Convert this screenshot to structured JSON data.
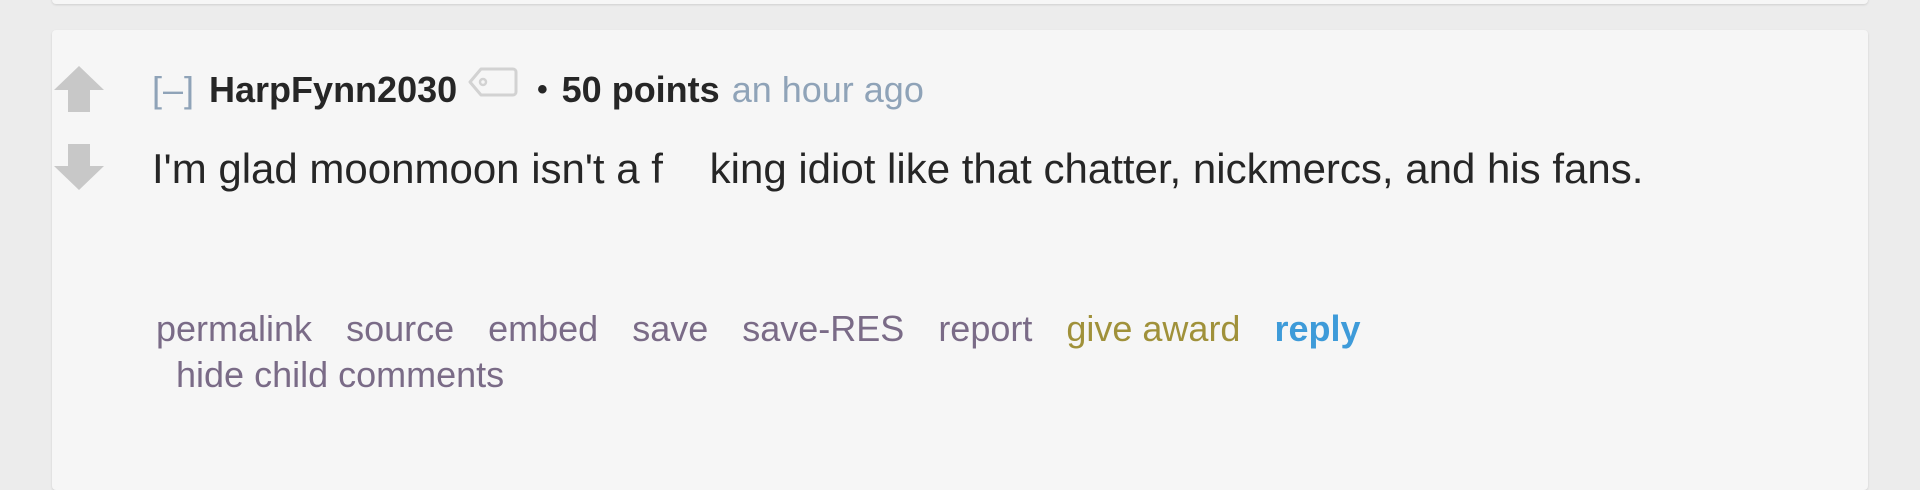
{
  "comment": {
    "collapse_toggle": "[–]",
    "author": "HarpFynn2030",
    "separator": "•",
    "score": "50 points",
    "time": "an hour ago",
    "body": "I'm glad moonmoon isn't a f    king idiot like that chatter, nickmercs, and his fans."
  },
  "actions": {
    "permalink": "permalink",
    "source": "source",
    "embed": "embed",
    "save": "save",
    "save_res": "save-RES",
    "report": "report",
    "give_award": "give award",
    "reply": "reply",
    "hide_child_comments": "hide child comments"
  },
  "icons": {
    "upvote": "arrow-up-icon",
    "downvote": "arrow-down-icon",
    "user_tag": "tag-icon"
  },
  "colors": {
    "page_background": "#ececec",
    "card_background": "#f6f6f6",
    "arrow": "#c8c8c8",
    "muted": "#8fa3b8",
    "action_link": "#7a6b87",
    "award": "#a0913a",
    "reply": "#3e9bd9"
  }
}
